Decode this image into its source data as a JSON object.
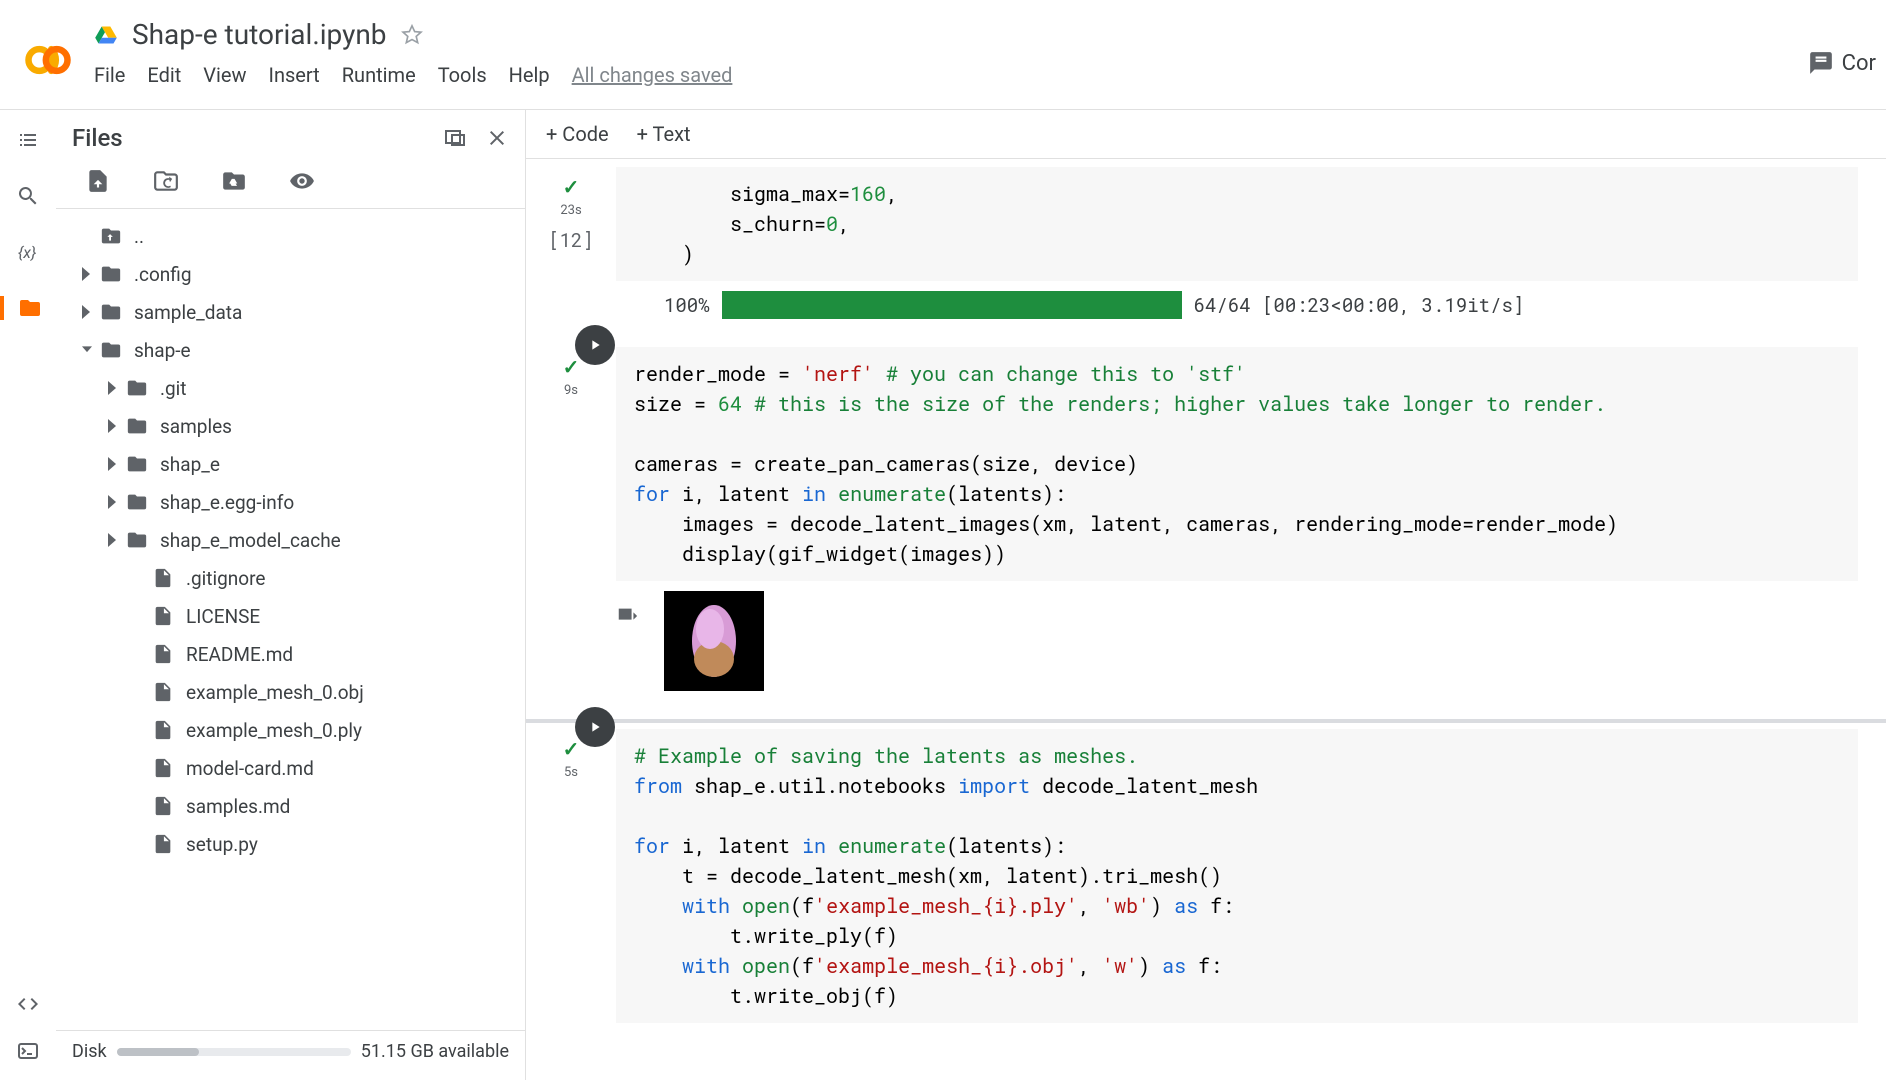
{
  "header": {
    "doc_title": "Shap-e tutorial.ipynb",
    "menus": [
      "File",
      "Edit",
      "View",
      "Insert",
      "Runtime",
      "Tools",
      "Help"
    ],
    "save_status": "All changes saved",
    "comment_label": "Cor"
  },
  "files_panel": {
    "title": "Files",
    "tree": [
      {
        "name": "..",
        "type": "folder-up",
        "depth": 0,
        "expandable": false
      },
      {
        "name": ".config",
        "type": "folder",
        "depth": 0,
        "expandable": true,
        "expanded": false
      },
      {
        "name": "sample_data",
        "type": "folder",
        "depth": 0,
        "expandable": true,
        "expanded": false
      },
      {
        "name": "shap-e",
        "type": "folder",
        "depth": 0,
        "expandable": true,
        "expanded": true
      },
      {
        "name": ".git",
        "type": "folder",
        "depth": 1,
        "expandable": true,
        "expanded": false
      },
      {
        "name": "samples",
        "type": "folder",
        "depth": 1,
        "expandable": true,
        "expanded": false
      },
      {
        "name": "shap_e",
        "type": "folder",
        "depth": 1,
        "expandable": true,
        "expanded": false
      },
      {
        "name": "shap_e.egg-info",
        "type": "folder",
        "depth": 1,
        "expandable": true,
        "expanded": false
      },
      {
        "name": "shap_e_model_cache",
        "type": "folder",
        "depth": 1,
        "expandable": true,
        "expanded": false
      },
      {
        "name": ".gitignore",
        "type": "file",
        "depth": 1,
        "expandable": false
      },
      {
        "name": "LICENSE",
        "type": "file",
        "depth": 1,
        "expandable": false
      },
      {
        "name": "README.md",
        "type": "file",
        "depth": 1,
        "expandable": false
      },
      {
        "name": "example_mesh_0.obj",
        "type": "file",
        "depth": 1,
        "expandable": false
      },
      {
        "name": "example_mesh_0.ply",
        "type": "file",
        "depth": 1,
        "expandable": false
      },
      {
        "name": "model-card.md",
        "type": "file",
        "depth": 1,
        "expandable": false
      },
      {
        "name": "samples.md",
        "type": "file",
        "depth": 1,
        "expandable": false
      },
      {
        "name": "setup.py",
        "type": "file",
        "depth": 1,
        "expandable": false
      }
    ],
    "disk_label": "Disk",
    "disk_available": "51.15 GB available",
    "disk_pct": 35
  },
  "toolbar": {
    "add_code": "+ Code",
    "add_text": "+ Text"
  },
  "cells": {
    "cell1": {
      "in_label": "[12]",
      "time": "23s",
      "code1": "        sigma_max=",
      "code2": "160",
      "code3": ",",
      "code4": "        s_churn=",
      "code5": "0",
      "code6": ",",
      "code7": "    )",
      "progress_pct": "100%",
      "progress_fill": 100,
      "progress_info": "64/64 [00:23<00:00, 3.19it/s]"
    },
    "cell2": {
      "time": "9s",
      "code": {
        "l1a": "render_mode = ",
        "l1b": "'nerf'",
        "l1c": " # you can change this to 'stf'",
        "l2a": "size = ",
        "l2b": "64",
        "l2c": " # this is the size of the renders; higher values take longer to render.",
        "l3": "",
        "l4": "cameras = create_pan_cameras(size, device)",
        "l5a": "for",
        "l5b": " i, latent ",
        "l5c": "in",
        "l5d": " enumerate",
        "l5e": "(latents):",
        "l6": "    images = decode_latent_images(xm, latent, cameras, rendering_mode=render_mode)",
        "l7a": "    display(",
        "l7b": "gif_widget",
        "l7c": "(images))"
      }
    },
    "cell3": {
      "time": "5s",
      "code": {
        "l1": "# Example of saving the latents as meshes.",
        "l2a": "from",
        "l2b": " shap_e.util.notebooks ",
        "l2c": "import",
        "l2d": " decode_latent_mesh",
        "l3": "",
        "l4a": "for",
        "l4b": " i, latent ",
        "l4c": "in",
        "l4d": " enumerate",
        "l4e": "(latents):",
        "l5": "    t = decode_latent_mesh(xm, latent).tri_mesh()",
        "l6a": "    ",
        "l6b": "with",
        "l6c": " open",
        "l6d": "(f",
        "l6e": "'example_mesh_{i}.ply'",
        "l6f": ", ",
        "l6g": "'wb'",
        "l6h": ") ",
        "l6i": "as",
        "l6j": " f:",
        "l7": "        t.write_ply(f)",
        "l8a": "    ",
        "l8b": "with",
        "l8c": " open",
        "l8d": "(f",
        "l8e": "'example_mesh_{i}.obj'",
        "l8f": ", ",
        "l8g": "'w'",
        "l8h": ") ",
        "l8i": "as",
        "l8j": " f:",
        "l9": "        t.write_obj(f)"
      }
    }
  }
}
